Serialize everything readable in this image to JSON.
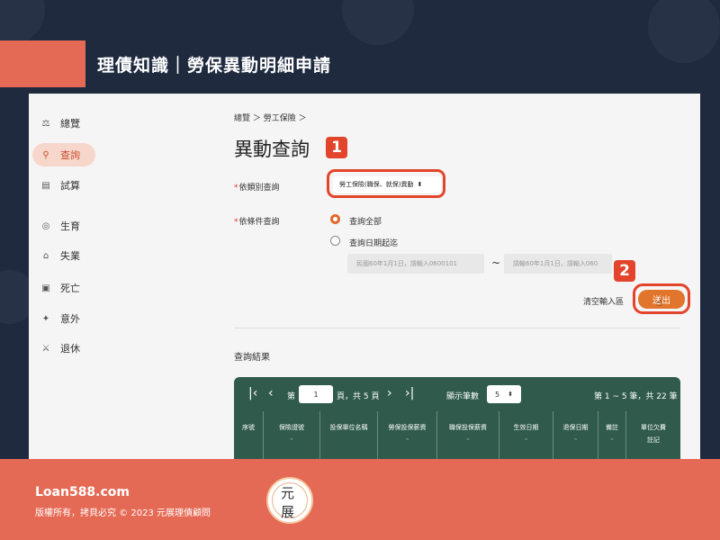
{
  "header": {
    "title": "理債知識｜勞保異動明細申請"
  },
  "sidebar": {
    "items": [
      {
        "label": "總覽",
        "icon": "scale-icon"
      },
      {
        "label": "查詢",
        "icon": "search-icon",
        "active": true
      },
      {
        "label": "試算",
        "icon": "calculator-icon"
      },
      {
        "label": "生育",
        "icon": "baby-icon"
      },
      {
        "label": "失業",
        "icon": "home-icon"
      },
      {
        "label": "死亡",
        "icon": "certificate-icon"
      },
      {
        "label": "意外",
        "icon": "accident-icon"
      },
      {
        "label": "退休",
        "icon": "retire-icon"
      }
    ]
  },
  "breadcrumb": "總覽 ＞ 勞工保險 ＞",
  "page_title": "異動查詢",
  "annotations": {
    "badge_1": "1",
    "badge_2": "2"
  },
  "form": {
    "category_label": "依類別查詢",
    "category_value": "勞工保險(職保、就保)異動",
    "condition_label": "依條件查詢",
    "radio_all": "查詢全部",
    "radio_date": "查詢日期起迄",
    "date_start_placeholder": "民國60年1月1日，請輸入0600101",
    "date_end_placeholder": "請輸60年1月1日，請輸入060",
    "tilde": "~",
    "clear_label": "清空輸入區",
    "submit_label": "送出"
  },
  "results": {
    "title": "查詢結果",
    "pager": {
      "page_prefix": "第",
      "current_page": "1",
      "page_suffix": "頁，共 5 頁",
      "rows_label": "顯示筆數",
      "rows_value": "5",
      "summary": "第 1 ~ 5 筆，共 22 筆"
    },
    "columns": [
      "序號",
      "保險證號",
      "投保單位名稱",
      "勞保投保薪資",
      "職保投保薪資",
      "生效日期",
      "退保日期",
      "備註",
      "單位欠費註記"
    ]
  },
  "footer": {
    "site": "Loan588.com",
    "copyright": "版權所有，拷貝必究 © 2023 元展理債顧問",
    "logo_top": "元",
    "logo_bottom": "展"
  },
  "colors": {
    "background": "#1f2a3f",
    "accent": "#e56a55",
    "highlight_red": "#e2452b",
    "submit_orange": "#e2752c",
    "table_green": "#2f5a4c"
  }
}
